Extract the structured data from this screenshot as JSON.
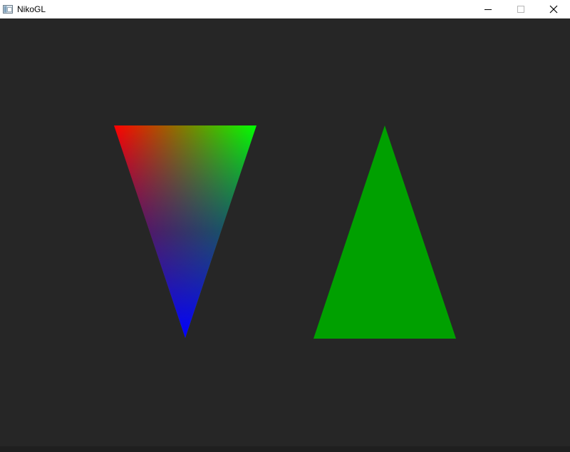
{
  "window": {
    "title": "NikoGL",
    "icon": "app-window-icon",
    "controls": [
      "minimize-icon",
      "maximize-icon",
      "close-icon"
    ]
  },
  "viewport": {
    "background": "#262626",
    "shapes": [
      {
        "name": "gradient-triangle",
        "orientation": "pointing-down",
        "vertex_colors": [
          "#ff0000",
          "#00ff00",
          "#0000ff"
        ]
      },
      {
        "name": "green-triangle",
        "orientation": "pointing-up",
        "fill": "#00a000"
      }
    ]
  }
}
